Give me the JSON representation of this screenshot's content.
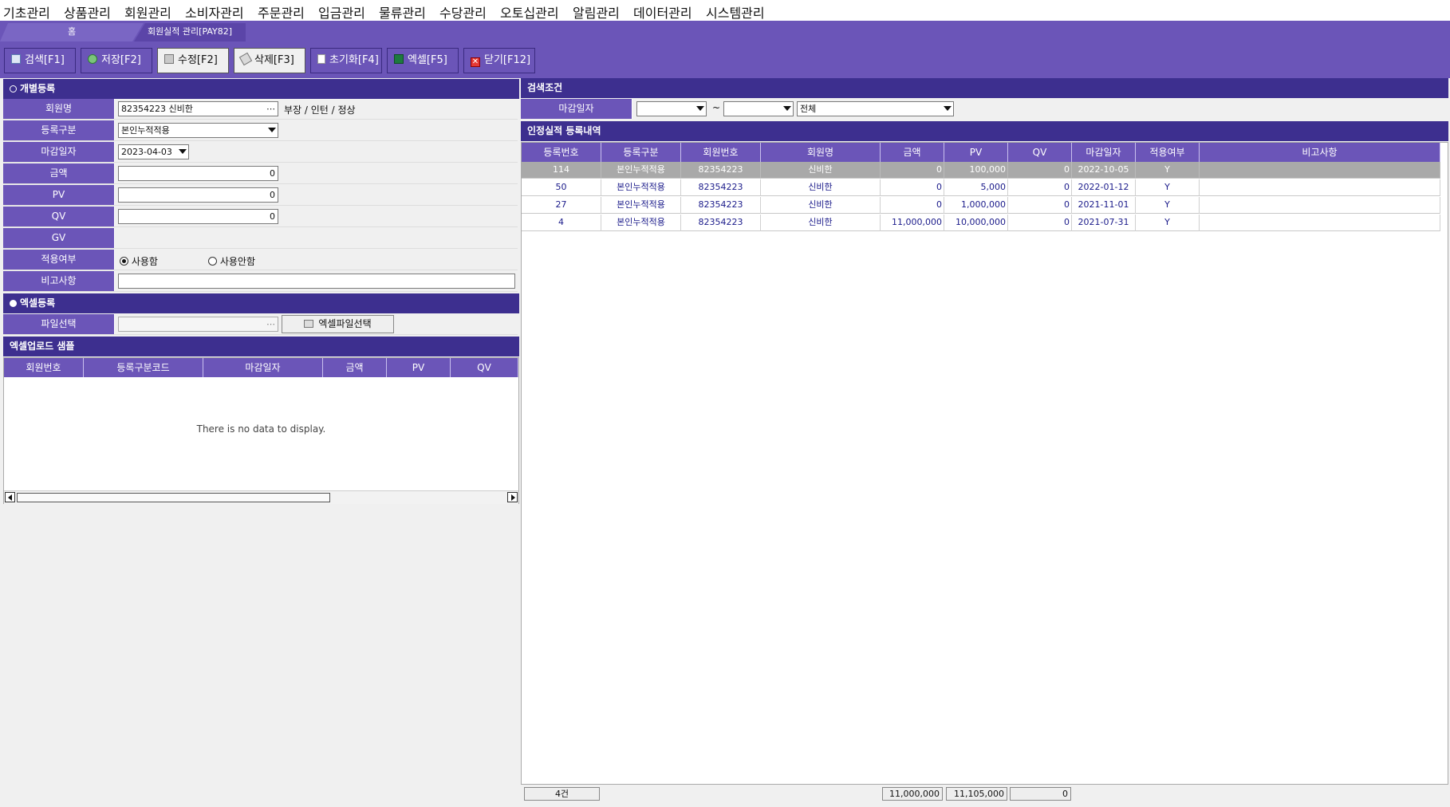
{
  "menu": [
    "기초관리",
    "상품관리",
    "회원관리",
    "소비자관리",
    "주문관리",
    "입금관리",
    "물류관리",
    "수당관리",
    "오토십관리",
    "알림관리",
    "데이터관리",
    "시스템관리"
  ],
  "tabs": {
    "home": "홈",
    "active": "회원실적 관리[PAY82]"
  },
  "toolbar": {
    "search": "검색[F1]",
    "save": "저장[F2]",
    "edit": "수정[F2]",
    "delete": "삭제[F3]",
    "reset": "초기화[F4]",
    "excel": "엑셀[F5]",
    "close": "닫기[F12]"
  },
  "individual": {
    "title": "개별등록",
    "member_label": "회원명",
    "member_value": "82354223 신비한",
    "member_info": "부장 / 인턴 / 정상",
    "type_label": "등록구분",
    "type_value": "본인누적적용",
    "close_date_label": "마감일자",
    "close_date_value": "2023-04-03",
    "amount_label": "금액",
    "amount_value": "0",
    "pv_label": "PV",
    "pv_value": "0",
    "qv_label": "QV",
    "qv_value": "0",
    "gv_label": "GV",
    "apply_label": "적용여부",
    "apply_yes": "사용함",
    "apply_no": "사용안함",
    "memo_label": "비고사항",
    "memo_value": ""
  },
  "excel_reg": {
    "title": "엑셀등록",
    "file_label": "파일선택",
    "file_value": "",
    "file_button": "엑셀파일선택"
  },
  "sample": {
    "title": "엑셀업로드 샘플",
    "columns": [
      "회원번호",
      "등록구분코드",
      "마감일자",
      "금액",
      "PV",
      "QV"
    ],
    "empty_text": "There is no data to display."
  },
  "search": {
    "title": "검색조건",
    "date_label": "마감일자",
    "date_from": "",
    "tilde": "~",
    "date_to": "",
    "type_value": "전체"
  },
  "history": {
    "title": "인정실적 등록내역",
    "columns": [
      "등록번호",
      "등록구분",
      "회원번호",
      "회원명",
      "금액",
      "PV",
      "QV",
      "마감일자",
      "적용여부",
      "비고사항"
    ],
    "rows": [
      [
        "114",
        "본인누적적용",
        "82354223",
        "신비한",
        "0",
        "100,000",
        "0",
        "2022-10-05",
        "Y",
        ""
      ],
      [
        "50",
        "본인누적적용",
        "82354223",
        "신비한",
        "0",
        "5,000",
        "0",
        "2022-01-12",
        "Y",
        ""
      ],
      [
        "27",
        "본인누적적용",
        "82354223",
        "신비한",
        "0",
        "1,000,000",
        "0",
        "2021-11-01",
        "Y",
        ""
      ],
      [
        "4",
        "본인누적적용",
        "82354223",
        "신비한",
        "11,000,000",
        "10,000,000",
        "0",
        "2021-07-31",
        "Y",
        ""
      ]
    ],
    "footer": {
      "count": "4건",
      "amount": "11,000,000",
      "pv": "11,105,000",
      "qv": "0"
    }
  },
  "colors": {
    "accent": "#6b55b8",
    "header_dark": "#3d2f8f",
    "selected_row": "#a9a9a9"
  }
}
